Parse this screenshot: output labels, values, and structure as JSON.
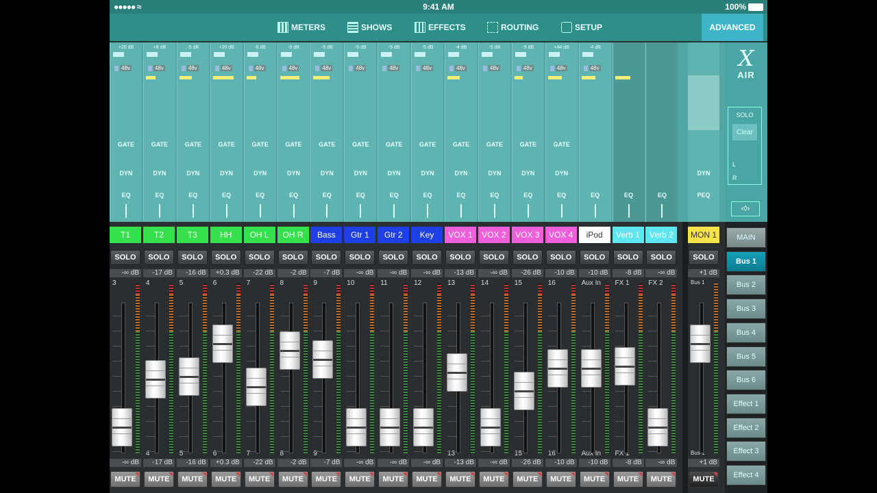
{
  "status": {
    "signal": "●●●●● ≈",
    "time": "9:41 AM",
    "battery": "100%"
  },
  "nav": {
    "meters": "METERS",
    "shows": "SHOWS",
    "effects": "EFFECTS",
    "routing": "ROUTING",
    "setup": "SETUP",
    "advanced": "ADVANCED"
  },
  "brand": {
    "x": "X",
    "air": "AIR"
  },
  "solo_panel": {
    "title": "SOLO",
    "clear": "Clear",
    "l": "L",
    "r": "R",
    "expand": "‹◊›"
  },
  "colors": {
    "green": "#35e04a",
    "blue": "#1f3fe6",
    "magenta": "#f05ed9",
    "white": "#ffffff",
    "cyan": "#5ce6f0",
    "yellow": "#f7e24a"
  },
  "strip_labels": {
    "gate": "GATE",
    "dyn": "DYN",
    "eq": "EQ",
    "peq": "PEQ",
    "p48": "48v"
  },
  "channels": [
    {
      "name": "T1",
      "color": "green",
      "gain": "+20 dB",
      "db": "-∞ dB",
      "num": "3",
      "num2": "",
      "fader": 0.18
    },
    {
      "name": "T2",
      "color": "green",
      "gain": "+8 dB",
      "db": "-17 dB",
      "num": "4",
      "num2": "4",
      "fader": 0.55
    },
    {
      "name": "T3",
      "color": "green",
      "gain": "-5 dB",
      "db": "-16 dB",
      "num": "5",
      "num2": "5",
      "fader": 0.57
    },
    {
      "name": "HH",
      "color": "green",
      "gain": "+20 dB",
      "db": "+0.3 dB",
      "num": "6",
      "num2": "6",
      "fader": 0.82
    },
    {
      "name": "OH L",
      "color": "green",
      "gain": "-8 dB",
      "db": "-22 dB",
      "num": "7",
      "num2": "7",
      "fader": 0.49
    },
    {
      "name": "OH R",
      "color": "green",
      "gain": "-5 dB",
      "db": "-2 dB",
      "num": "8",
      "num2": "8",
      "fader": 0.77
    },
    {
      "name": "Bass",
      "color": "blue",
      "gain": "-5 dB",
      "db": "-7 dB",
      "num": "9",
      "num2": "9",
      "fader": 0.7
    },
    {
      "name": "Gtr 1",
      "color": "blue",
      "gain": "-5 dB",
      "db": "-∞ dB",
      "num": "10",
      "num2": "",
      "fader": 0.18
    },
    {
      "name": "Gtr 2",
      "color": "blue",
      "gain": "-5 dB",
      "db": "-∞ dB",
      "num": "11",
      "num2": "",
      "fader": 0.18
    },
    {
      "name": "Key",
      "color": "blue",
      "gain": "-5 dB",
      "db": "-∞ dB",
      "num": "12",
      "num2": "",
      "fader": 0.18
    },
    {
      "name": "VOX 1",
      "color": "magenta",
      "gain": "-4 dB",
      "db": "-13 dB",
      "num": "13",
      "num2": "13",
      "fader": 0.6
    },
    {
      "name": "VOX 2",
      "color": "magenta",
      "gain": "-5 dB",
      "db": "-∞ dB",
      "num": "14",
      "num2": "",
      "fader": 0.18
    },
    {
      "name": "VOX 3",
      "color": "magenta",
      "gain": "-5 dB",
      "db": "-26 dB",
      "num": "15",
      "num2": "15",
      "fader": 0.46
    },
    {
      "name": "VOX 4",
      "color": "magenta",
      "gain": "+44 dB",
      "db": "-10 dB",
      "num": "16",
      "num2": "16",
      "fader": 0.63
    },
    {
      "name": "iPod",
      "color": "white",
      "gain": "-4 dB",
      "db": "-10 dB",
      "num": "Aux In",
      "num2": "Aux In",
      "fader": 0.63
    },
    {
      "name": "Verb 1",
      "color": "cyan",
      "gain": "",
      "db": "-8 dB",
      "num": "FX 1",
      "num2": "FX 1",
      "fader": 0.65
    },
    {
      "name": "Verb 2",
      "color": "cyan",
      "gain": "",
      "db": "-∞ dB",
      "num": "FX 2",
      "num2": "",
      "fader": 0.18
    }
  ],
  "main": {
    "name": "MON 1",
    "color": "yellow",
    "solo": "SOLO",
    "db": "+1 dB",
    "num": "Bus 1",
    "num2": "Bus 1",
    "mute": "MUTE",
    "fader": 0.82
  },
  "buttons": {
    "solo": "SOLO",
    "mute": "MUTE"
  },
  "buses": [
    "MAIN",
    "Bus 1",
    "Bus 2",
    "Bus 3",
    "Bus 4",
    "Bus 5",
    "Bus 6",
    "Effect 1",
    "Effect 2",
    "Effect 3",
    "Effect 4"
  ],
  "selected_bus": "Bus 1"
}
